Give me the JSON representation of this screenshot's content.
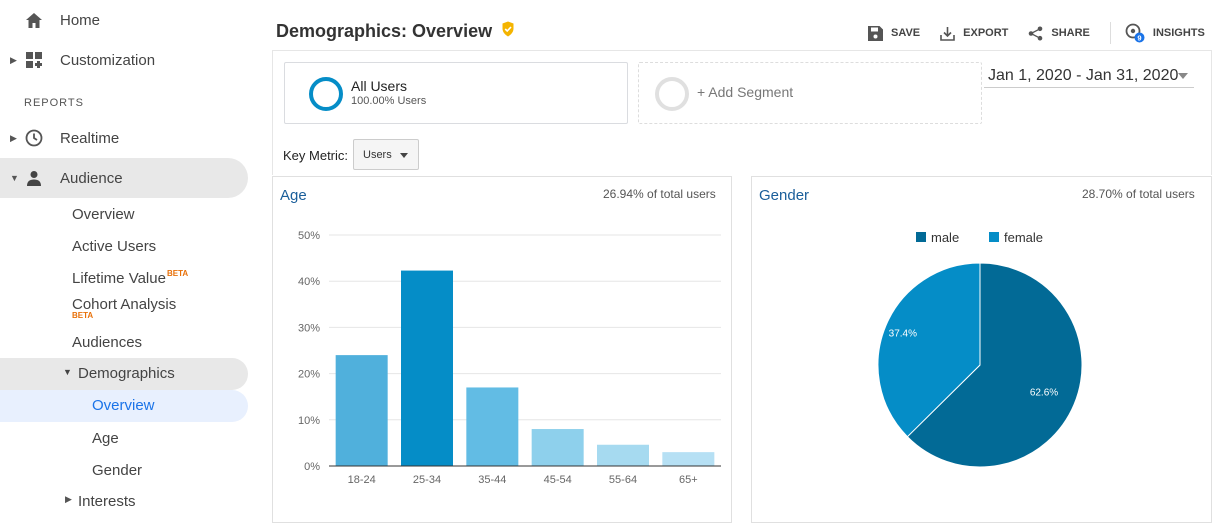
{
  "sidebar": {
    "home": "Home",
    "customization": "Customization",
    "reports_label": "REPORTS",
    "realtime": "Realtime",
    "audience": "Audience",
    "audience_items": {
      "overview": "Overview",
      "active_users": "Active Users",
      "lifetime_value": "Lifetime Value",
      "lifetime_value_badge": "BETA",
      "cohort_analysis": "Cohort Analysis",
      "cohort_badge": "BETA",
      "audiences": "Audiences"
    },
    "demographics": "Demographics",
    "demographics_items": {
      "overview": "Overview",
      "age": "Age",
      "gender": "Gender"
    },
    "interests": "Interests"
  },
  "header": {
    "title": "Demographics: Overview",
    "save": "SAVE",
    "export": "EXPORT",
    "share": "SHARE",
    "insights": "INSIGHTS",
    "insights_count": "9"
  },
  "segment": {
    "name": "All Users",
    "percent": "100.00% Users",
    "add_label": "+ Add Segment"
  },
  "date_range": "Jan 1, 2020 - Jan 31, 2020",
  "key_metric": {
    "label": "Key Metric:",
    "value": "Users"
  },
  "colors": {
    "accent": "#058dc7",
    "male": "#026a96",
    "female": "#058dc7",
    "verified": "#f4b400"
  },
  "chart_data": [
    {
      "type": "bar",
      "title": "Age",
      "subtitle": "26.94% of total users",
      "categories": [
        "18-24",
        "25-34",
        "35-44",
        "45-54",
        "55-64",
        "65+"
      ],
      "values": [
        24,
        42.3,
        17,
        8,
        4.6,
        3
      ],
      "yticks": [
        "0%",
        "10%",
        "20%",
        "30%",
        "40%",
        "50%"
      ],
      "ylim": [
        0,
        50
      ],
      "bar_colors": [
        "#50b0dc",
        "#058dc7",
        "#62bce4",
        "#8ed0ec",
        "#a6daf0",
        "#b6e0f4"
      ],
      "grid": true
    },
    {
      "type": "pie",
      "title": "Gender",
      "subtitle": "28.70% of total users",
      "legend": [
        "male",
        "female"
      ],
      "legend_position": "top",
      "values": [
        62.6,
        37.4
      ],
      "labels": [
        "62.6%",
        "37.4%"
      ]
    }
  ]
}
